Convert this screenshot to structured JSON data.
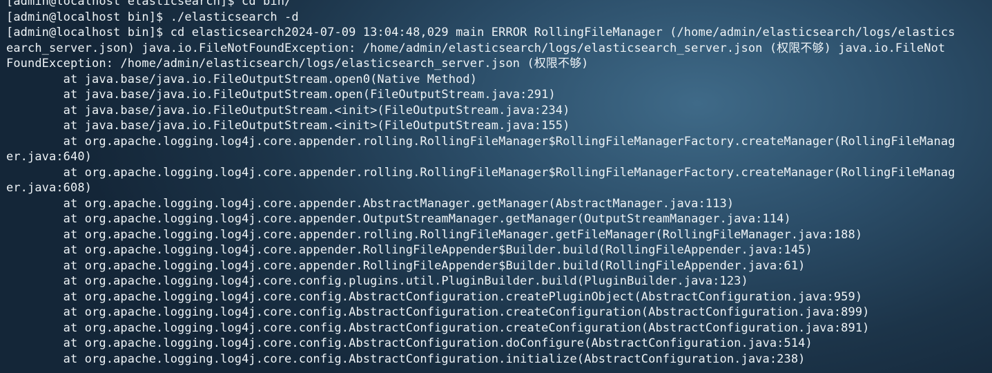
{
  "terminal": {
    "lines": [
      "[admin@localhost elasticsearch]$ cd bin/",
      "[admin@localhost bin]$ ./elasticsearch -d",
      "[admin@localhost bin]$ cd elasticsearch2024-07-09 13:04:48,029 main ERROR RollingFileManager (/home/admin/elasticsearch/logs/elastics",
      "earch_server.json) java.io.FileNotFoundException: /home/admin/elasticsearch/logs/elasticsearch_server.json (权限不够) java.io.FileNot",
      "FoundException: /home/admin/elasticsearch/logs/elasticsearch_server.json (权限不够)",
      "        at java.base/java.io.FileOutputStream.open0(Native Method)",
      "        at java.base/java.io.FileOutputStream.open(FileOutputStream.java:291)",
      "        at java.base/java.io.FileOutputStream.<init>(FileOutputStream.java:234)",
      "        at java.base/java.io.FileOutputStream.<init>(FileOutputStream.java:155)",
      "        at org.apache.logging.log4j.core.appender.rolling.RollingFileManager$RollingFileManagerFactory.createManager(RollingFileManag",
      "er.java:640)",
      "        at org.apache.logging.log4j.core.appender.rolling.RollingFileManager$RollingFileManagerFactory.createManager(RollingFileManag",
      "er.java:608)",
      "        at org.apache.logging.log4j.core.appender.AbstractManager.getManager(AbstractManager.java:113)",
      "        at org.apache.logging.log4j.core.appender.OutputStreamManager.getManager(OutputStreamManager.java:114)",
      "        at org.apache.logging.log4j.core.appender.rolling.RollingFileManager.getFileManager(RollingFileManager.java:188)",
      "        at org.apache.logging.log4j.core.appender.RollingFileAppender$Builder.build(RollingFileAppender.java:145)",
      "        at org.apache.logging.log4j.core.appender.RollingFileAppender$Builder.build(RollingFileAppender.java:61)",
      "        at org.apache.logging.log4j.core.config.plugins.util.PluginBuilder.build(PluginBuilder.java:123)",
      "        at org.apache.logging.log4j.core.config.AbstractConfiguration.createPluginObject(AbstractConfiguration.java:959)",
      "        at org.apache.logging.log4j.core.config.AbstractConfiguration.createConfiguration(AbstractConfiguration.java:899)",
      "        at org.apache.logging.log4j.core.config.AbstractConfiguration.createConfiguration(AbstractConfiguration.java:891)",
      "        at org.apache.logging.log4j.core.config.AbstractConfiguration.doConfigure(AbstractConfiguration.java:514)",
      "        at org.apache.logging.log4j.core.config.AbstractConfiguration.initialize(AbstractConfiguration.java:238)"
    ]
  }
}
